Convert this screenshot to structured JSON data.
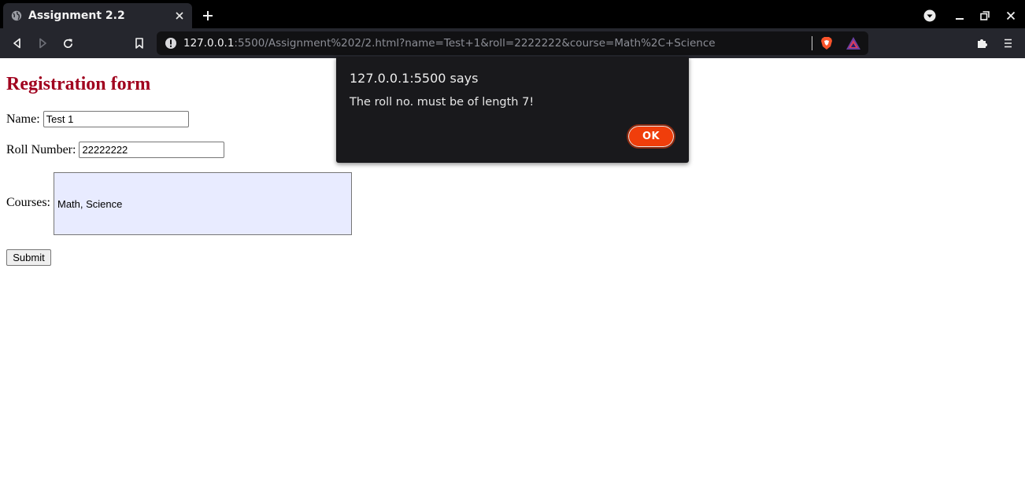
{
  "browser": {
    "tab_title": "Assignment 2.2",
    "url_host": "127.0.0.1",
    "url_rest": ":5500/Assignment%202/2.html?name=Test+1&roll=2222222&course=Math%2C+Science"
  },
  "form": {
    "heading": "Registration form",
    "name_label": "Name:",
    "name_value": "Test 1",
    "roll_label": "Roll Number:",
    "roll_value": "22222222",
    "courses_label": "Courses:",
    "courses_value": "Math, Science",
    "submit_label": "Submit",
    "heading_color": "#a0001e",
    "textarea_bg": "#e8ebff"
  },
  "alert": {
    "title": "127.0.0.1:5500 says",
    "message": "The roll no. must be of length 7!",
    "ok_label": "OK",
    "ok_color": "#f03e0b"
  },
  "icons": {
    "tab": [
      "globe-icon",
      "close-icon",
      "plus-icon"
    ],
    "window": [
      "profile-dropdown-icon",
      "minimize-icon",
      "restore-icon",
      "close-window-icon"
    ],
    "toolbar": [
      "back-icon",
      "forward-icon",
      "reload-icon",
      "bookmark-icon",
      "info-icon",
      "brave-shield-icon",
      "brave-rewards-icon",
      "extensions-icon",
      "menu-icon"
    ]
  }
}
